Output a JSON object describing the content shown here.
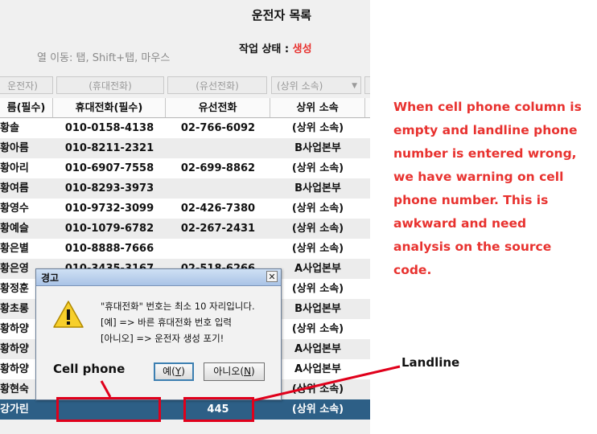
{
  "window": {
    "title": "운전자 목록",
    "hint": "열 이동: 탭, Shift+탭, 마우스",
    "status_label": "작업 상태 :",
    "status_value": "생성"
  },
  "filters": {
    "name": "운전자)",
    "mobile": "(휴대전화)",
    "landline": "(유선전화)",
    "org": "(상위 소속)"
  },
  "columns": {
    "name": "름(필수)",
    "mobile": "휴대전화(필수)",
    "landline": "유선전화",
    "org": "상위 소속"
  },
  "rows": [
    {
      "name": "황솔",
      "mobile": "010-0158-4138",
      "landline": "02-766-6092",
      "org": "(상위 소속)"
    },
    {
      "name": "황아름",
      "mobile": "010-8211-2321",
      "landline": "",
      "org": "B사업본부"
    },
    {
      "name": "황아리",
      "mobile": "010-6907-7558",
      "landline": "02-699-8862",
      "org": "(상위 소속)"
    },
    {
      "name": "황여름",
      "mobile": "010-8293-3973",
      "landline": "",
      "org": "B사업본부"
    },
    {
      "name": "황영수",
      "mobile": "010-9732-3099",
      "landline": "02-426-7380",
      "org": "(상위 소속)"
    },
    {
      "name": "황예슬",
      "mobile": "010-1079-6782",
      "landline": "02-267-2431",
      "org": "(상위 소속)"
    },
    {
      "name": "황은별",
      "mobile": "010-8888-7666",
      "landline": "",
      "org": "(상위 소속)"
    },
    {
      "name": "황은영",
      "mobile": "010-3435-3167",
      "landline": "02-518-6266",
      "org": "A사업본부"
    },
    {
      "name": "황정훈",
      "mobile": "",
      "landline": "",
      "org": "(상위 소속)"
    },
    {
      "name": "황초롱",
      "mobile": "",
      "landline": "",
      "org": "B사업본부"
    },
    {
      "name": "황하양",
      "mobile": "",
      "landline": "",
      "org": "(상위 소속)"
    },
    {
      "name": "황하양",
      "mobile": "",
      "landline": "",
      "org": "A사업본부"
    },
    {
      "name": "황하양",
      "mobile": "",
      "landline": "",
      "org": "A사업본부"
    },
    {
      "name": "황현숙",
      "mobile": "",
      "landline": "",
      "org": "(상위 소속)"
    }
  ],
  "selected_row": {
    "name": "강가린",
    "mobile": "",
    "landline": "445",
    "org": "(상위 소속)"
  },
  "dialog": {
    "title": "경고",
    "close": "✕",
    "line1": "\"휴대전화\" 번호는 최소 10 자리입니다.",
    "line2": "[예] => 바른 휴대전화 번호 입력",
    "line3": "[아니오] => 운전자 생성 포기!",
    "yes_label": "예",
    "yes_key": "Y",
    "no_label": "아니오",
    "no_key": "N"
  },
  "annotations": {
    "note": "When cell phone column is empty and landline phone number is entered wrong, we have warning on cell phone number. This is awkward and need analysis on the source code.",
    "cell_phone_label": "Cell phone",
    "landline_label": "Landline"
  },
  "colors": {
    "selected_row": "#2d5f86",
    "annotation_red": "#e0001b",
    "status_red": "#e8322f"
  }
}
